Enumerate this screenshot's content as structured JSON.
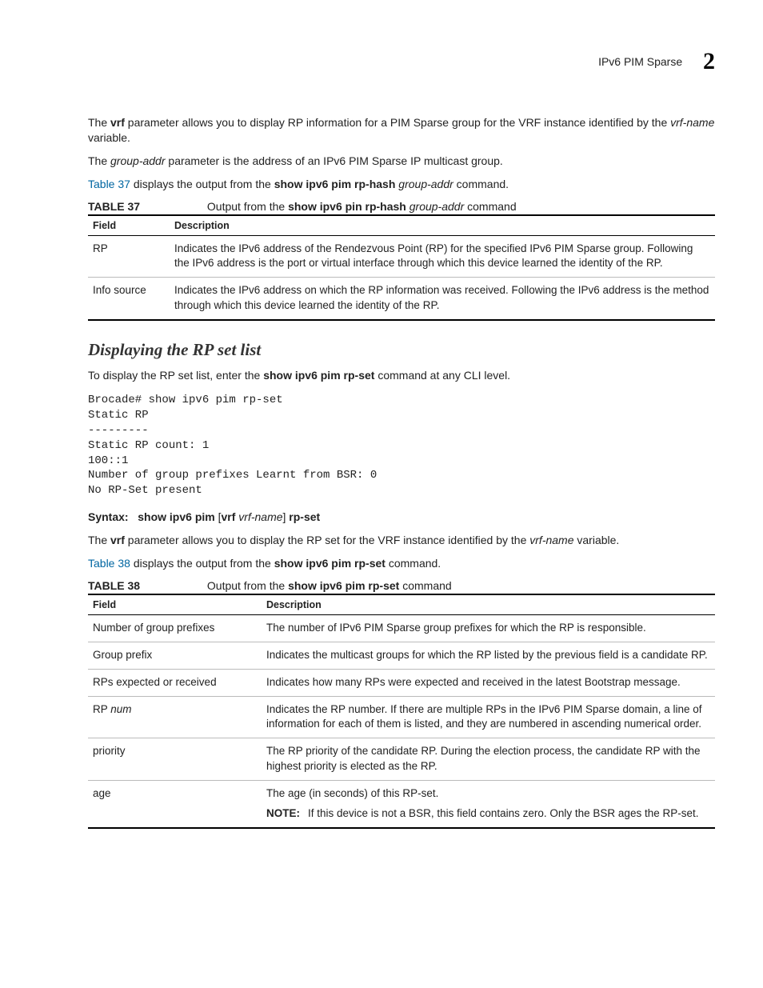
{
  "header": {
    "title": "IPv6 PIM Sparse",
    "chapter": "2"
  },
  "para1": {
    "pre": "The ",
    "b1": "vrf",
    "mid": " parameter allows you to display RP information for a PIM Sparse group for the VRF instance identified by the ",
    "i1": "vrf-name",
    "post": " variable."
  },
  "para2": {
    "pre": "The ",
    "i1": "group-addr",
    "post": " parameter is the address of an IPv6 PIM Sparse IP multicast group."
  },
  "para3": {
    "link": "Table 37",
    "mid": " displays the output from the ",
    "b1": "show ipv6 pim rp-hash ",
    "i1": "group-addr",
    "post": " command."
  },
  "table37": {
    "label": "TABLE 37",
    "caption_pre": "Output from the ",
    "caption_b": "show ipv6 pin rp-hash ",
    "caption_i": "group-addr",
    "caption_post": " command",
    "h1": "Field",
    "h2": "Description",
    "rows": [
      {
        "f": "RP",
        "d": "Indicates the IPv6 address of the Rendezvous Point (RP) for the specified IPv6 PIM Sparse group. Following the IPv6 address is the port or virtual interface through which this device learned the identity of the RP."
      },
      {
        "f": "Info source",
        "d": "Indicates the IPv6 address on which the RP information was received. Following the IPv6 address is the method through which this device learned the identity of the RP."
      }
    ]
  },
  "section2": "Displaying the RP set list",
  "para4": {
    "pre": "To display the RP set list, enter the ",
    "b1": "show ipv6 pim rp-set",
    "post": " command at any CLI level."
  },
  "code": "Brocade# show ipv6 pim rp-set\nStatic RP\n---------\nStatic RP count: 1\n100::1\nNumber of group prefixes Learnt from BSR: 0\nNo RP-Set present",
  "syntax": {
    "label": "Syntax:",
    "cmd1": "show ipv6 pim ",
    "br1": "[",
    "b_vrf": "vrf ",
    "i_vrfname": "vrf-name",
    "br2": "]",
    "cmd2": " rp-set"
  },
  "para5": {
    "pre": "The ",
    "b1": "vrf",
    "mid": " parameter allows you to display the RP set for the VRF instance identified by the ",
    "i1": "vrf-name",
    "post": " variable."
  },
  "para6": {
    "link": "Table 38",
    "mid": " displays the output from the ",
    "b1": "show ipv6 pim rp-set",
    "post": " command."
  },
  "table38": {
    "label": "TABLE 38",
    "caption_pre": "Output from the ",
    "caption_b": "show ipv6 pim rp-set",
    "caption_post": " command",
    "h1": "Field",
    "h2": "Description",
    "rows": [
      {
        "f": "Number of group prefixes",
        "d": "The number of IPv6 PIM Sparse group prefixes for which the RP is responsible."
      },
      {
        "f": "Group prefix",
        "d": "Indicates the multicast groups for which the RP listed by the previous field is a candidate RP."
      },
      {
        "f": "RPs expected or received",
        "d": "Indicates how many RPs were expected and received in the latest Bootstrap message."
      },
      {
        "f_pre": "RP ",
        "f_i": "num",
        "d": "Indicates the RP number.  If there are multiple RPs in the IPv6 PIM Sparse domain, a line of information for each of them is listed, and they are numbered in ascending numerical order."
      },
      {
        "f": "priority",
        "d": "The RP priority of the candidate RP.  During the election process, the candidate RP with the highest priority is elected as the RP."
      },
      {
        "f": "age",
        "d": "The age (in seconds) of this RP-set.",
        "note_label": "NOTE:",
        "note": "If this device is not a BSR, this field contains zero. Only the BSR ages the RP-set."
      }
    ]
  }
}
